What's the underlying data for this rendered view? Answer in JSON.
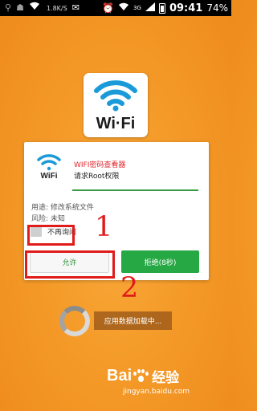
{
  "status_bar": {
    "speed": "1.8K/S",
    "network_label": "3G",
    "time": "09:41",
    "battery": "74%"
  },
  "app_icon": {
    "label": "Wi·Fi"
  },
  "dialog": {
    "title": "WIFI密码查看器",
    "subtitle": "请求Root权限",
    "icon_label": "WiFi",
    "purpose": "用途: 修改系统文件",
    "risk": "风险: 未知",
    "checkbox_label": "不再询问",
    "allow_button": "允许",
    "deny_button": "拒绝(8秒)"
  },
  "annotations": {
    "step1": "1",
    "step2": "2"
  },
  "loading": {
    "text": "应用数据加载中..."
  },
  "watermark": {
    "logo_left": "Bai",
    "logo_right": "经验",
    "url": "jingyan.baidu.com"
  },
  "colors": {
    "background": "#f49a28",
    "wifi_blue": "#1a9ad8",
    "title_red": "#e0242b",
    "accent_green": "#26a844",
    "annotation_red": "#e11a1a"
  }
}
